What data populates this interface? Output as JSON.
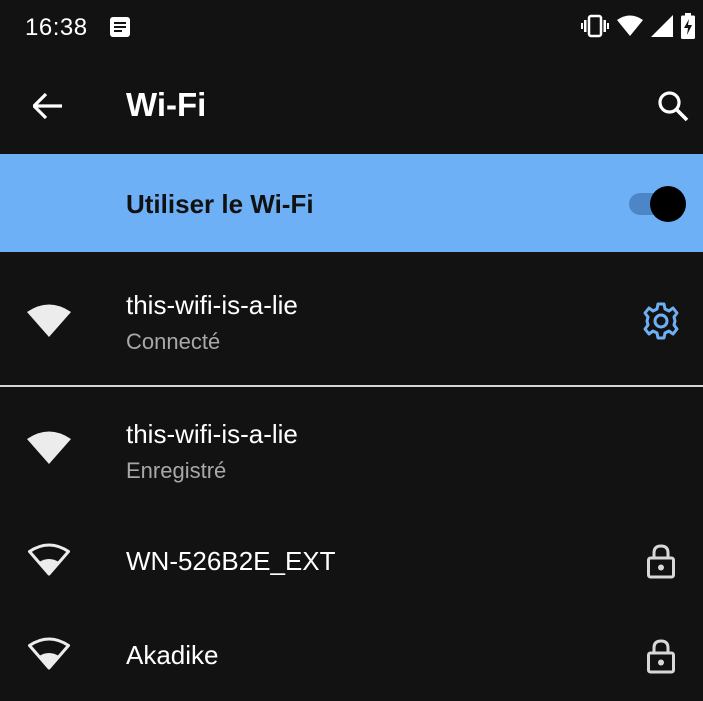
{
  "status_bar": {
    "time": "16:38",
    "icons": [
      "notification-message-icon",
      "vibrate-icon",
      "wifi-signal-icon",
      "cell-signal-icon",
      "battery-charging-icon"
    ]
  },
  "app_bar": {
    "title": "Wi-Fi",
    "back_icon": "arrow-back-icon",
    "search_icon": "search-icon"
  },
  "wifi_switch": {
    "label": "Utiliser le Wi-Fi",
    "enabled": true,
    "background_color": "#6eb0f6"
  },
  "networks": [
    {
      "name": "this-wifi-is-a-lie",
      "status": "Connecté",
      "signal": "full",
      "trailing_icon": "settings-gear-icon"
    },
    {
      "name": "this-wifi-is-a-lie",
      "status": "Enregistré",
      "signal": "full",
      "trailing_icon": ""
    },
    {
      "name": "WN-526B2E_EXT",
      "status": "",
      "signal": "outline",
      "trailing_icon": "lock-icon"
    },
    {
      "name": "Akadike",
      "status": "",
      "signal": "outline",
      "trailing_icon": "lock-icon"
    }
  ],
  "colors": {
    "background": "#121212",
    "accent": "#6eb0f6",
    "secondary_text": "#a8a8a8"
  }
}
